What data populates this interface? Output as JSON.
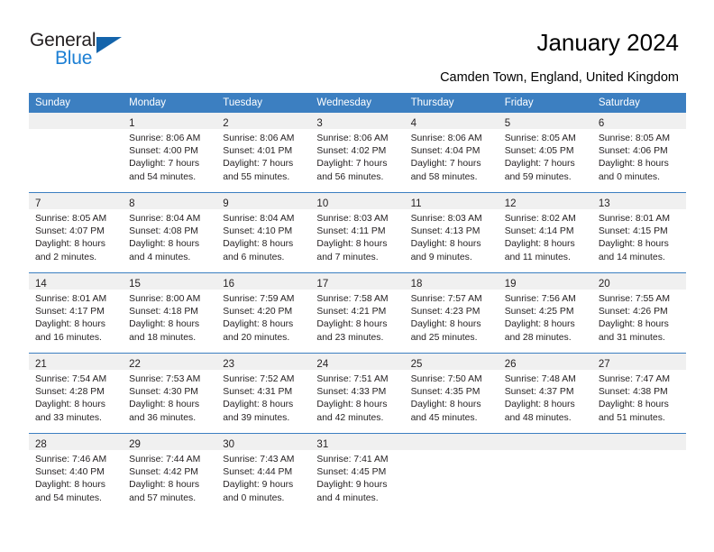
{
  "brand": {
    "name_part1": "General",
    "name_part2": "Blue",
    "triangle_color": "#1464ab",
    "blue_color": "#1c7fd4"
  },
  "header": {
    "title": "January 2024",
    "location": "Camden Town, England, United Kingdom"
  },
  "theme": {
    "header_bg": "#3c7fc1",
    "daynum_band_bg": "#f0f0f0",
    "row_divider": "#3c7fc1",
    "text": "#231f20"
  },
  "weekday_headers": [
    "Sunday",
    "Monday",
    "Tuesday",
    "Wednesday",
    "Thursday",
    "Friday",
    "Saturday"
  ],
  "weeks": [
    {
      "days": [
        {
          "number": "",
          "lines": []
        },
        {
          "number": "1",
          "lines": [
            "Sunrise: 8:06 AM",
            "Sunset: 4:00 PM",
            "Daylight: 7 hours",
            "and 54 minutes."
          ]
        },
        {
          "number": "2",
          "lines": [
            "Sunrise: 8:06 AM",
            "Sunset: 4:01 PM",
            "Daylight: 7 hours",
            "and 55 minutes."
          ]
        },
        {
          "number": "3",
          "lines": [
            "Sunrise: 8:06 AM",
            "Sunset: 4:02 PM",
            "Daylight: 7 hours",
            "and 56 minutes."
          ]
        },
        {
          "number": "4",
          "lines": [
            "Sunrise: 8:06 AM",
            "Sunset: 4:04 PM",
            "Daylight: 7 hours",
            "and 58 minutes."
          ]
        },
        {
          "number": "5",
          "lines": [
            "Sunrise: 8:05 AM",
            "Sunset: 4:05 PM",
            "Daylight: 7 hours",
            "and 59 minutes."
          ]
        },
        {
          "number": "6",
          "lines": [
            "Sunrise: 8:05 AM",
            "Sunset: 4:06 PM",
            "Daylight: 8 hours",
            "and 0 minutes."
          ]
        }
      ]
    },
    {
      "days": [
        {
          "number": "7",
          "lines": [
            "Sunrise: 8:05 AM",
            "Sunset: 4:07 PM",
            "Daylight: 8 hours",
            "and 2 minutes."
          ]
        },
        {
          "number": "8",
          "lines": [
            "Sunrise: 8:04 AM",
            "Sunset: 4:08 PM",
            "Daylight: 8 hours",
            "and 4 minutes."
          ]
        },
        {
          "number": "9",
          "lines": [
            "Sunrise: 8:04 AM",
            "Sunset: 4:10 PM",
            "Daylight: 8 hours",
            "and 6 minutes."
          ]
        },
        {
          "number": "10",
          "lines": [
            "Sunrise: 8:03 AM",
            "Sunset: 4:11 PM",
            "Daylight: 8 hours",
            "and 7 minutes."
          ]
        },
        {
          "number": "11",
          "lines": [
            "Sunrise: 8:03 AM",
            "Sunset: 4:13 PM",
            "Daylight: 8 hours",
            "and 9 minutes."
          ]
        },
        {
          "number": "12",
          "lines": [
            "Sunrise: 8:02 AM",
            "Sunset: 4:14 PM",
            "Daylight: 8 hours",
            "and 11 minutes."
          ]
        },
        {
          "number": "13",
          "lines": [
            "Sunrise: 8:01 AM",
            "Sunset: 4:15 PM",
            "Daylight: 8 hours",
            "and 14 minutes."
          ]
        }
      ]
    },
    {
      "days": [
        {
          "number": "14",
          "lines": [
            "Sunrise: 8:01 AM",
            "Sunset: 4:17 PM",
            "Daylight: 8 hours",
            "and 16 minutes."
          ]
        },
        {
          "number": "15",
          "lines": [
            "Sunrise: 8:00 AM",
            "Sunset: 4:18 PM",
            "Daylight: 8 hours",
            "and 18 minutes."
          ]
        },
        {
          "number": "16",
          "lines": [
            "Sunrise: 7:59 AM",
            "Sunset: 4:20 PM",
            "Daylight: 8 hours",
            "and 20 minutes."
          ]
        },
        {
          "number": "17",
          "lines": [
            "Sunrise: 7:58 AM",
            "Sunset: 4:21 PM",
            "Daylight: 8 hours",
            "and 23 minutes."
          ]
        },
        {
          "number": "18",
          "lines": [
            "Sunrise: 7:57 AM",
            "Sunset: 4:23 PM",
            "Daylight: 8 hours",
            "and 25 minutes."
          ]
        },
        {
          "number": "19",
          "lines": [
            "Sunrise: 7:56 AM",
            "Sunset: 4:25 PM",
            "Daylight: 8 hours",
            "and 28 minutes."
          ]
        },
        {
          "number": "20",
          "lines": [
            "Sunrise: 7:55 AM",
            "Sunset: 4:26 PM",
            "Daylight: 8 hours",
            "and 31 minutes."
          ]
        }
      ]
    },
    {
      "days": [
        {
          "number": "21",
          "lines": [
            "Sunrise: 7:54 AM",
            "Sunset: 4:28 PM",
            "Daylight: 8 hours",
            "and 33 minutes."
          ]
        },
        {
          "number": "22",
          "lines": [
            "Sunrise: 7:53 AM",
            "Sunset: 4:30 PM",
            "Daylight: 8 hours",
            "and 36 minutes."
          ]
        },
        {
          "number": "23",
          "lines": [
            "Sunrise: 7:52 AM",
            "Sunset: 4:31 PM",
            "Daylight: 8 hours",
            "and 39 minutes."
          ]
        },
        {
          "number": "24",
          "lines": [
            "Sunrise: 7:51 AM",
            "Sunset: 4:33 PM",
            "Daylight: 8 hours",
            "and 42 minutes."
          ]
        },
        {
          "number": "25",
          "lines": [
            "Sunrise: 7:50 AM",
            "Sunset: 4:35 PM",
            "Daylight: 8 hours",
            "and 45 minutes."
          ]
        },
        {
          "number": "26",
          "lines": [
            "Sunrise: 7:48 AM",
            "Sunset: 4:37 PM",
            "Daylight: 8 hours",
            "and 48 minutes."
          ]
        },
        {
          "number": "27",
          "lines": [
            "Sunrise: 7:47 AM",
            "Sunset: 4:38 PM",
            "Daylight: 8 hours",
            "and 51 minutes."
          ]
        }
      ]
    },
    {
      "days": [
        {
          "number": "28",
          "lines": [
            "Sunrise: 7:46 AM",
            "Sunset: 4:40 PM",
            "Daylight: 8 hours",
            "and 54 minutes."
          ]
        },
        {
          "number": "29",
          "lines": [
            "Sunrise: 7:44 AM",
            "Sunset: 4:42 PM",
            "Daylight: 8 hours",
            "and 57 minutes."
          ]
        },
        {
          "number": "30",
          "lines": [
            "Sunrise: 7:43 AM",
            "Sunset: 4:44 PM",
            "Daylight: 9 hours",
            "and 0 minutes."
          ]
        },
        {
          "number": "31",
          "lines": [
            "Sunrise: 7:41 AM",
            "Sunset: 4:45 PM",
            "Daylight: 9 hours",
            "and 4 minutes."
          ]
        },
        {
          "number": "",
          "lines": []
        },
        {
          "number": "",
          "lines": []
        },
        {
          "number": "",
          "lines": []
        }
      ]
    }
  ]
}
